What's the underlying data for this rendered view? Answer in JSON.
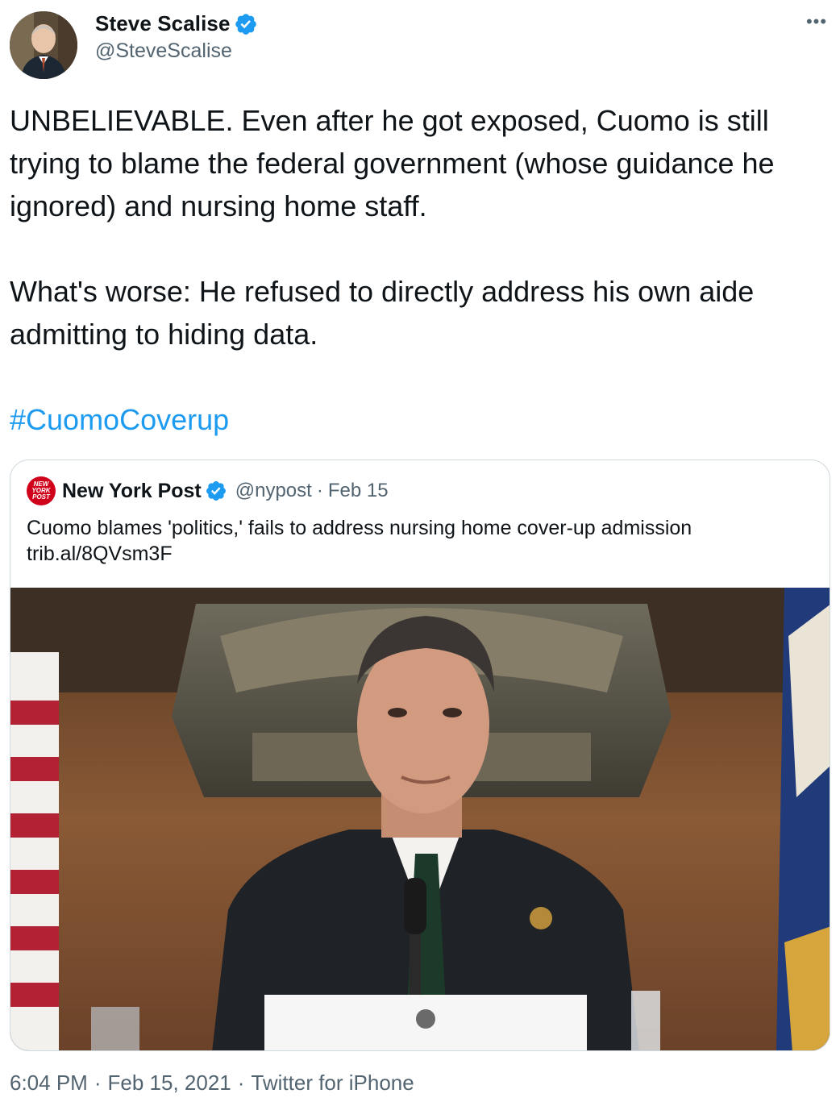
{
  "author": {
    "display_name": "Steve Scalise",
    "handle": "@SteveScalise",
    "verified": true
  },
  "tweet": {
    "paragraph_1": "UNBELIEVABLE. Even after he got exposed, Cuomo is still trying to blame the federal government (whose guidance he ignored) and nursing home staff.",
    "paragraph_2": "What's worse: He refused to directly address his own aide admitting to hiding data.",
    "hashtag": "#CuomoCoverup"
  },
  "quoted_tweet": {
    "logo_lines": [
      "NEW",
      "YORK",
      "POST"
    ],
    "display_name": "New York Post",
    "handle": "@nypost",
    "separator": "·",
    "date": "Feb 15",
    "text": "Cuomo blames 'politics,' fails to address nursing home cover-up admission",
    "link": "trib.al/8QVsm3F"
  },
  "footer": {
    "time": "6:04 PM",
    "date": "Feb 15, 2021",
    "source": "Twitter for iPhone",
    "separator": "·"
  },
  "icons": {
    "more": "more-horizontal-icon",
    "verified": "verified-badge-icon"
  },
  "colors": {
    "link": "#1d9bf0",
    "secondary_text": "#536471",
    "border": "#cfd9de",
    "nypost_red": "#d0021b"
  }
}
